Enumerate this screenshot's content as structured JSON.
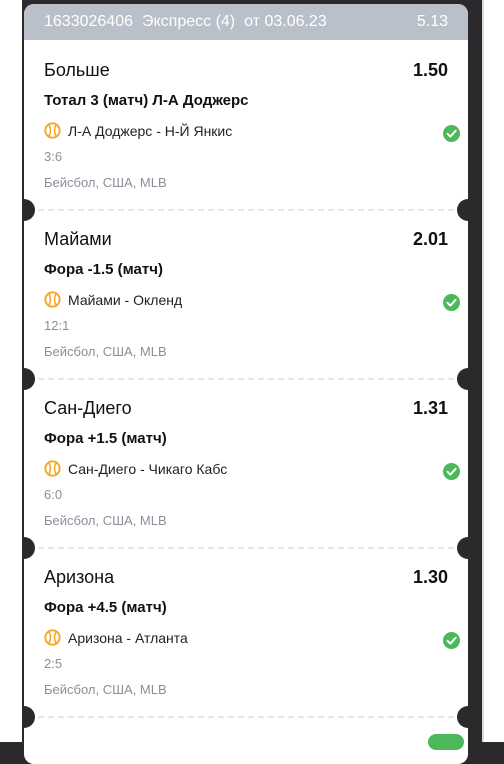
{
  "ticket": {
    "id": "1633026406",
    "type": "Экспресс (4)",
    "date": "от 03.06.23",
    "total_odds": "5.13"
  },
  "colors": {
    "header_bg": "#b9c0ca",
    "win_check": "#4db85a",
    "baseball_icon": "#f5a623"
  },
  "bets": [
    {
      "selection": "Больше",
      "odds": "1.50",
      "market": "Тотал 3 (матч)  Л-А Доджерс",
      "match": "Л-А Доджерс - Н-Й Янкис",
      "score": "3:6",
      "league": "Бейсбол, США, MLB",
      "icon": "baseball-icon",
      "status": "won"
    },
    {
      "selection": "Майами",
      "odds": "2.01",
      "market": "Фора -1.5 (матч)",
      "match": "Майами - Окленд",
      "score": "12:1",
      "league": "Бейсбол, США, MLB",
      "icon": "baseball-icon",
      "status": "won"
    },
    {
      "selection": "Сан-Диего",
      "odds": "1.31",
      "market": "Фора +1.5 (матч)",
      "match": "Сан-Диего - Чикаго Кабс",
      "score": "6:0",
      "league": "Бейсбол, США, MLB",
      "icon": "baseball-icon",
      "status": "won"
    },
    {
      "selection": "Аризона",
      "odds": "1.30",
      "market": "Фора +4.5 (матч)",
      "match": "Аризона - Атланта",
      "score": "2:5",
      "league": "Бейсбол, США, MLB",
      "icon": "baseball-icon",
      "status": "won"
    }
  ]
}
